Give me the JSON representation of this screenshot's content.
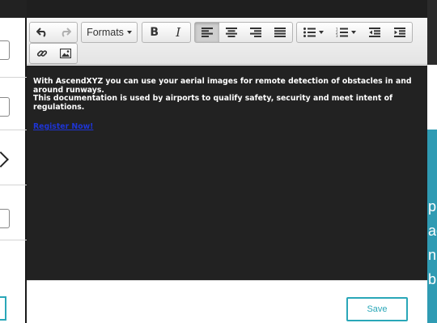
{
  "toolbar": {
    "formats_label": "Formats",
    "bold_glyph": "B",
    "italic_glyph": "I"
  },
  "editor": {
    "paragraph_line1": "With AscendXYZ you can use your aerial images for remote detection of obstacles in and around runways.",
    "paragraph_line2": "This documentation is used by airports to qualify safety, security and meet intent of regulations.",
    "link_text": "Register Now!"
  },
  "footer": {
    "save_label": "Save"
  },
  "right_panel": {
    "fragments": [
      "pl",
      "ag",
      "n",
      "b"
    ]
  },
  "colors": {
    "accent": "#2aa7b8",
    "editor_background": "#222222",
    "link": "#1e35d6",
    "right_panel_teal": "#2f9bb3"
  }
}
